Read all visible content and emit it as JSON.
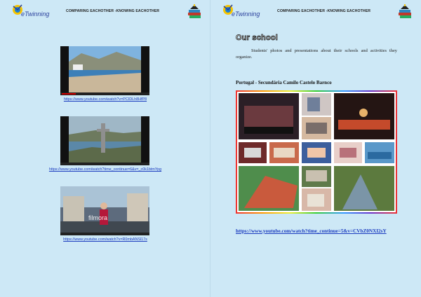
{
  "header": {
    "title": "COMPARING EACHOTHER -KNOWING EACHOTHER",
    "logo_text": "eTwinning"
  },
  "left_page": {
    "videos": [
      {
        "link": "https://www.youtube.com/watch?v=PCIDLh8HfP8"
      },
      {
        "link": "https://www.youtube.com/watch?time_continue=6&v=_c0k1btmYpg"
      },
      {
        "link": "https://www.youtube.com/watch?v=R0mbANSl17s"
      }
    ],
    "filmora_label": "filmora"
  },
  "right_page": {
    "section_title": "Our school",
    "intro": "Students' photos and presentations about their schools and activities they organize.",
    "school_name": "Portugal - Secundária Camilo Castelo Barnco",
    "video_link": "https://www.youtube.com/watch?time_continue=5&v=CVbZ0NXI2sY"
  },
  "colors": {
    "background": "#cde8f6",
    "link": "#1a3bbf"
  }
}
